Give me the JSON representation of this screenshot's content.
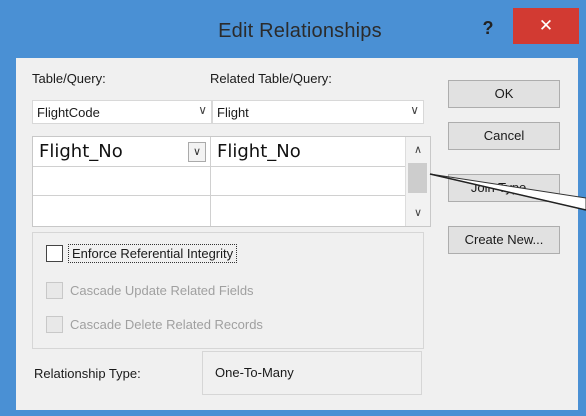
{
  "window": {
    "title": "Edit Relationships",
    "help_label": "?",
    "close_label": "✕"
  },
  "table_query": {
    "label": "Table/Query:",
    "value": "FlightCode"
  },
  "related_table_query": {
    "label": "Related Table/Query:",
    "value": "Flight"
  },
  "fields_grid": {
    "rows": [
      {
        "left": "Flight_No",
        "right": "Flight_No"
      },
      {
        "left": "",
        "right": ""
      },
      {
        "left": "",
        "right": ""
      }
    ]
  },
  "buttons": {
    "ok": "OK",
    "cancel": "Cancel",
    "join_type": "Join Type...",
    "create_new": "Create New..."
  },
  "options": {
    "enforce_integrity": {
      "label": "Enforce Referential Integrity",
      "checked": false,
      "enabled": true
    },
    "cascade_update": {
      "label": "Cascade Update Related Fields",
      "checked": false,
      "enabled": false
    },
    "cascade_delete": {
      "label": "Cascade Delete Related Records",
      "checked": false,
      "enabled": false
    }
  },
  "relationship_type": {
    "label": "Relationship Type:",
    "value": "One-To-Many"
  },
  "colors": {
    "frame": "#4a90d4",
    "close": "#d23a32",
    "client": "#f0f0f0"
  }
}
